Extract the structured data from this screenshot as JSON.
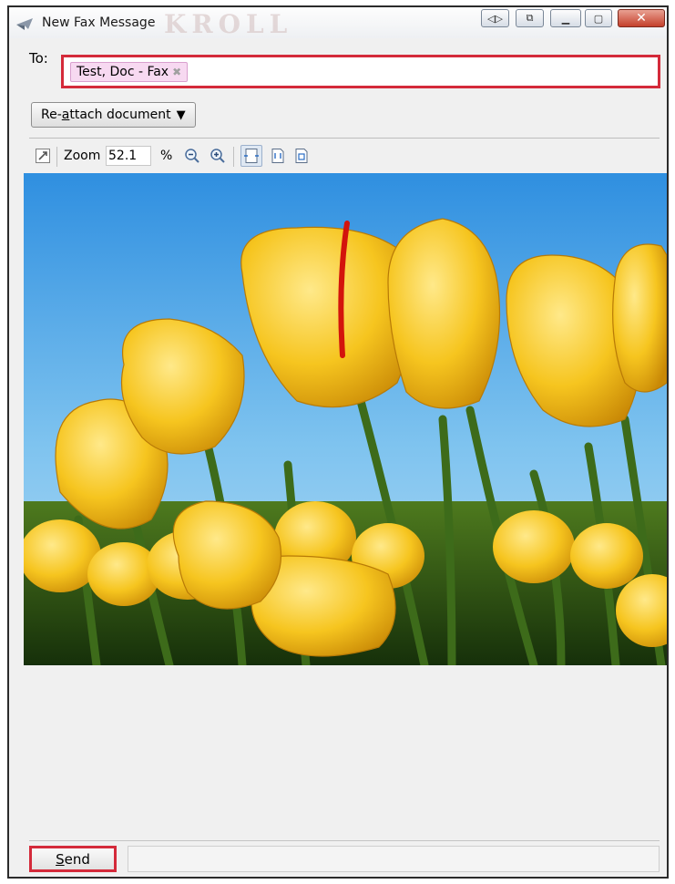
{
  "window": {
    "title": "New Fax Message",
    "watermark": "KROLL"
  },
  "recipient": {
    "label": "To:",
    "chip": "Test, Doc - Fax",
    "chip_remove": "✖"
  },
  "reattach": {
    "label_pre": "Re-",
    "label_u": "a",
    "label_post": "ttach document",
    "arrow": "▼"
  },
  "zoom": {
    "label": "Zoom",
    "value": "52.1",
    "unit": "%"
  },
  "send": {
    "label_u": "S",
    "label_post": "end"
  },
  "icons": {
    "app": "fax-plane-icon",
    "toolbar": [
      "maximize-preview-icon",
      "zoom-out-icon",
      "zoom-in-icon",
      "fit-page-icon",
      "fit-width-icon",
      "actual-size-icon"
    ]
  },
  "colors": {
    "highlight": "#d42a3a",
    "chip_bg": "#f7d9f1"
  }
}
